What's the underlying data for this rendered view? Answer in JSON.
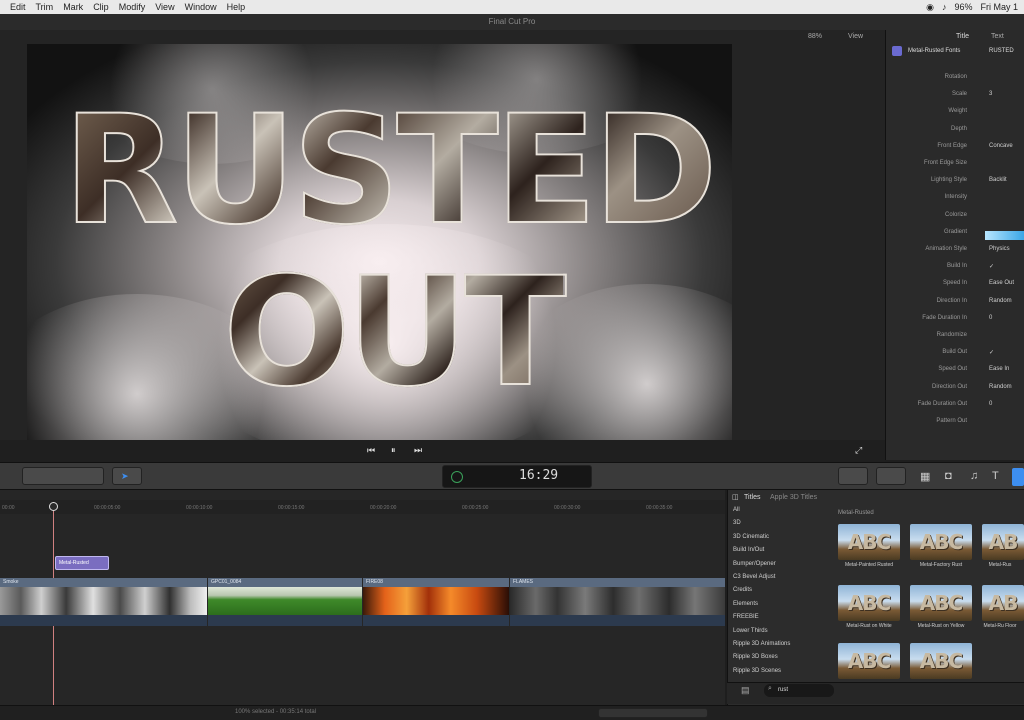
{
  "menubar": {
    "items": [
      "Edit",
      "Trim",
      "Mark",
      "Clip",
      "Modify",
      "View",
      "Window",
      "Help"
    ],
    "battery": "96%",
    "clock": "Fri May 1"
  },
  "window": {
    "title": "Final Cut Pro"
  },
  "viewer": {
    "zoom": "88%",
    "view_label": "View",
    "title_line1": "RUSTED",
    "title_line2": "OUT"
  },
  "inspector": {
    "tabs": [
      "Title",
      "Text"
    ],
    "preset_name": "Metal-Rusted Fonts",
    "preset_value": "RUSTED",
    "rows": [
      {
        "label": "Rotation",
        "value": ""
      },
      {
        "label": "Scale",
        "value": "3"
      },
      {
        "label": "Weight",
        "value": ""
      },
      {
        "label": "Depth",
        "value": ""
      },
      {
        "label": "Front Edge",
        "value": "Concave"
      },
      {
        "label": "Front Edge Size",
        "value": ""
      },
      {
        "label": "Lighting Style",
        "value": "Backlit"
      },
      {
        "label": "Intensity",
        "value": ""
      },
      {
        "label": "Colorize",
        "value": ""
      },
      {
        "label": "Gradient",
        "value": ""
      },
      {
        "label": "Animation Style",
        "value": "Physics"
      },
      {
        "label": "Build In",
        "value": "✓"
      },
      {
        "label": "Speed In",
        "value": "Ease Out"
      },
      {
        "label": "Direction In",
        "value": "Random"
      },
      {
        "label": "Fade Duration In",
        "value": "0"
      },
      {
        "label": "Randomize",
        "value": ""
      },
      {
        "label": "Build Out",
        "value": "✓"
      },
      {
        "label": "Speed Out",
        "value": "Ease In"
      },
      {
        "label": "Direction Out",
        "value": "Random"
      },
      {
        "label": "Fade Duration Out",
        "value": "0"
      },
      {
        "label": "Pattern Out",
        "value": ""
      }
    ]
  },
  "toolbar": {
    "timecode": "16:29"
  },
  "timeline": {
    "ruler": [
      "00:00",
      "00:00:05:00",
      "00:00:10:00",
      "00:00:15:00",
      "00:00:20:00",
      "00:00:25:00",
      "00:00:30:00",
      "00:00:35:00"
    ],
    "title_clip": "Metal-Rusted",
    "clips": [
      {
        "label": "Smoke"
      },
      {
        "label": "GPC01_0084"
      },
      {
        "label": "FIRE08"
      },
      {
        "label": "FLAMES"
      }
    ]
  },
  "browser": {
    "header": "Titles",
    "header_sub": "Apple 3D Titles",
    "section": "Metal-Rusted",
    "categories": [
      "All",
      "3D",
      "3D Cinematic",
      "Build In/Out",
      "Bumper/Opener",
      "C3 Bevel Adjust",
      "Credits",
      "Elements",
      "FREEBIE",
      "Lower Thirds",
      "Ripple 3D Animations",
      "Ripple 3D Boxes",
      "Ripple 3D Scenes"
    ],
    "tiles": [
      {
        "glyph": "ABC",
        "name": "Metal-Painted Rusted"
      },
      {
        "glyph": "ABC",
        "name": "Metal-Factory Rust"
      },
      {
        "glyph": "AB",
        "name": "Metal-Rus"
      },
      {
        "glyph": "ABC",
        "name": "Metal-Rust on White"
      },
      {
        "glyph": "ABC",
        "name": "Metal-Rust on Yellow"
      },
      {
        "glyph": "AB",
        "name": "Metal-Ru Floor"
      },
      {
        "glyph": "ABC",
        "name": ""
      },
      {
        "glyph": "ABC",
        "name": ""
      }
    ],
    "search_value": "rust"
  },
  "statusbar": {
    "text": "100% selected - 00:35:14 total"
  }
}
